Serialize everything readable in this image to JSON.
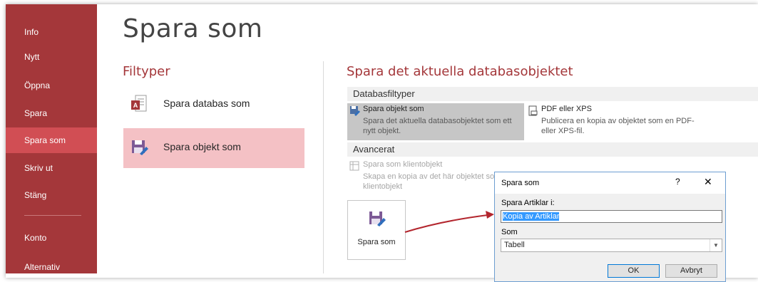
{
  "sidebar": {
    "items": [
      {
        "label": "Info"
      },
      {
        "label": "Nytt"
      },
      {
        "label": "Öppna"
      },
      {
        "label": "Spara"
      },
      {
        "label": "Spara som"
      },
      {
        "label": "Skriv ut"
      },
      {
        "label": "Stäng"
      },
      {
        "label": "Konto"
      },
      {
        "label": "Alternativ"
      }
    ],
    "active_index": 4
  },
  "main": {
    "title": "Spara som",
    "filetypes_heading": "Filtyper",
    "filetypes": [
      {
        "label": "Spara databas som",
        "icon": "access-database-icon"
      },
      {
        "label": "Spara objekt som",
        "icon": "save-object-icon",
        "selected": true
      }
    ],
    "right_heading": "Spara det aktuella databasobjektet",
    "db_group": "Databasfiltyper",
    "options": {
      "save_object": {
        "title": "Spara objekt som",
        "desc": "Spara det aktuella databasobjektet som ett nytt objekt.",
        "icon": "save-as-icon"
      },
      "pdf": {
        "title": "PDF eller XPS",
        "desc": "Publicera en kopia av objektet som en PDF- eller XPS-fil.",
        "icon": "pdf-document-icon"
      },
      "client": {
        "title": "Spara som klientobjekt",
        "desc": "Skapa en kopia av det här objektet som klientobjekt",
        "icon": "client-object-icon"
      }
    },
    "adv_group": "Avancerat",
    "big_button_label": "Spara som"
  },
  "dialog": {
    "title": "Spara som",
    "help": "?",
    "close": "✕",
    "save_label": "Spara Artiklar i:",
    "save_value": "Kopia av Artiklar",
    "type_label": "Som",
    "type_value": "Tabell",
    "ok": "OK",
    "cancel": "Avbryt"
  },
  "colors": {
    "sidebar": "#a4373a",
    "sidebar_active": "#d14e54",
    "accent": "#a4373a",
    "selection": "#f4c1c5"
  }
}
